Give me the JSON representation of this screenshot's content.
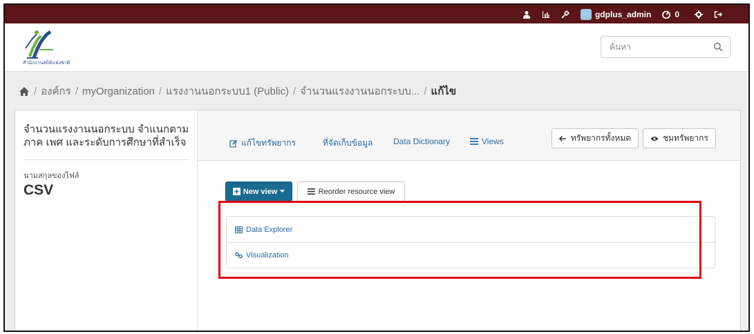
{
  "topbar": {
    "username": "gdplus_admin",
    "dashboard_count": "0",
    "icons": [
      "user-icon",
      "chart-icon",
      "tools-icon",
      "dashboard-icon",
      "gear-icon",
      "sign-out-icon"
    ]
  },
  "header": {
    "logo_caption": "สำนักงานสถิติแห่งชาติ",
    "search_placeholder": "ค้นหา"
  },
  "breadcrumb": {
    "items": [
      "องค์กร",
      "myOrganization",
      "แรงงานนอกระบบ1 (Public)",
      "จำนวนแรงงานนอกระบบ..."
    ],
    "active": "แก้ไข"
  },
  "sidebar": {
    "resource_title": "จำนวนแรงงานนอกระบบ จำแนกตาม ภาค เพศ และระดับการศึกษาที่สำเร็จ",
    "format_label": "นามสกุลของไฟล์",
    "format_value": "CSV"
  },
  "tabs": {
    "edit_resource": "แก้ไขทรัพยากร",
    "datastore": "ที่จัดเก็บข้อมูล",
    "data_dictionary": "Data Dictionary",
    "views": "Views"
  },
  "actions": {
    "all_resources": "ทรัพยากรทั้งหมด",
    "view_resource": "ชมทรัพยากร"
  },
  "view_toolbar": {
    "new_view": "New view",
    "reorder": "Reorder resource view"
  },
  "views_list": [
    {
      "label": "Data Explorer",
      "icon": "table-icon"
    },
    {
      "label": "Visualization",
      "icon": "link-icon"
    }
  ],
  "colors": {
    "topbar": "#5a1518",
    "link": "#2b6aa0",
    "primary_button": "#1a6b8f",
    "highlight": "#e0000f"
  }
}
